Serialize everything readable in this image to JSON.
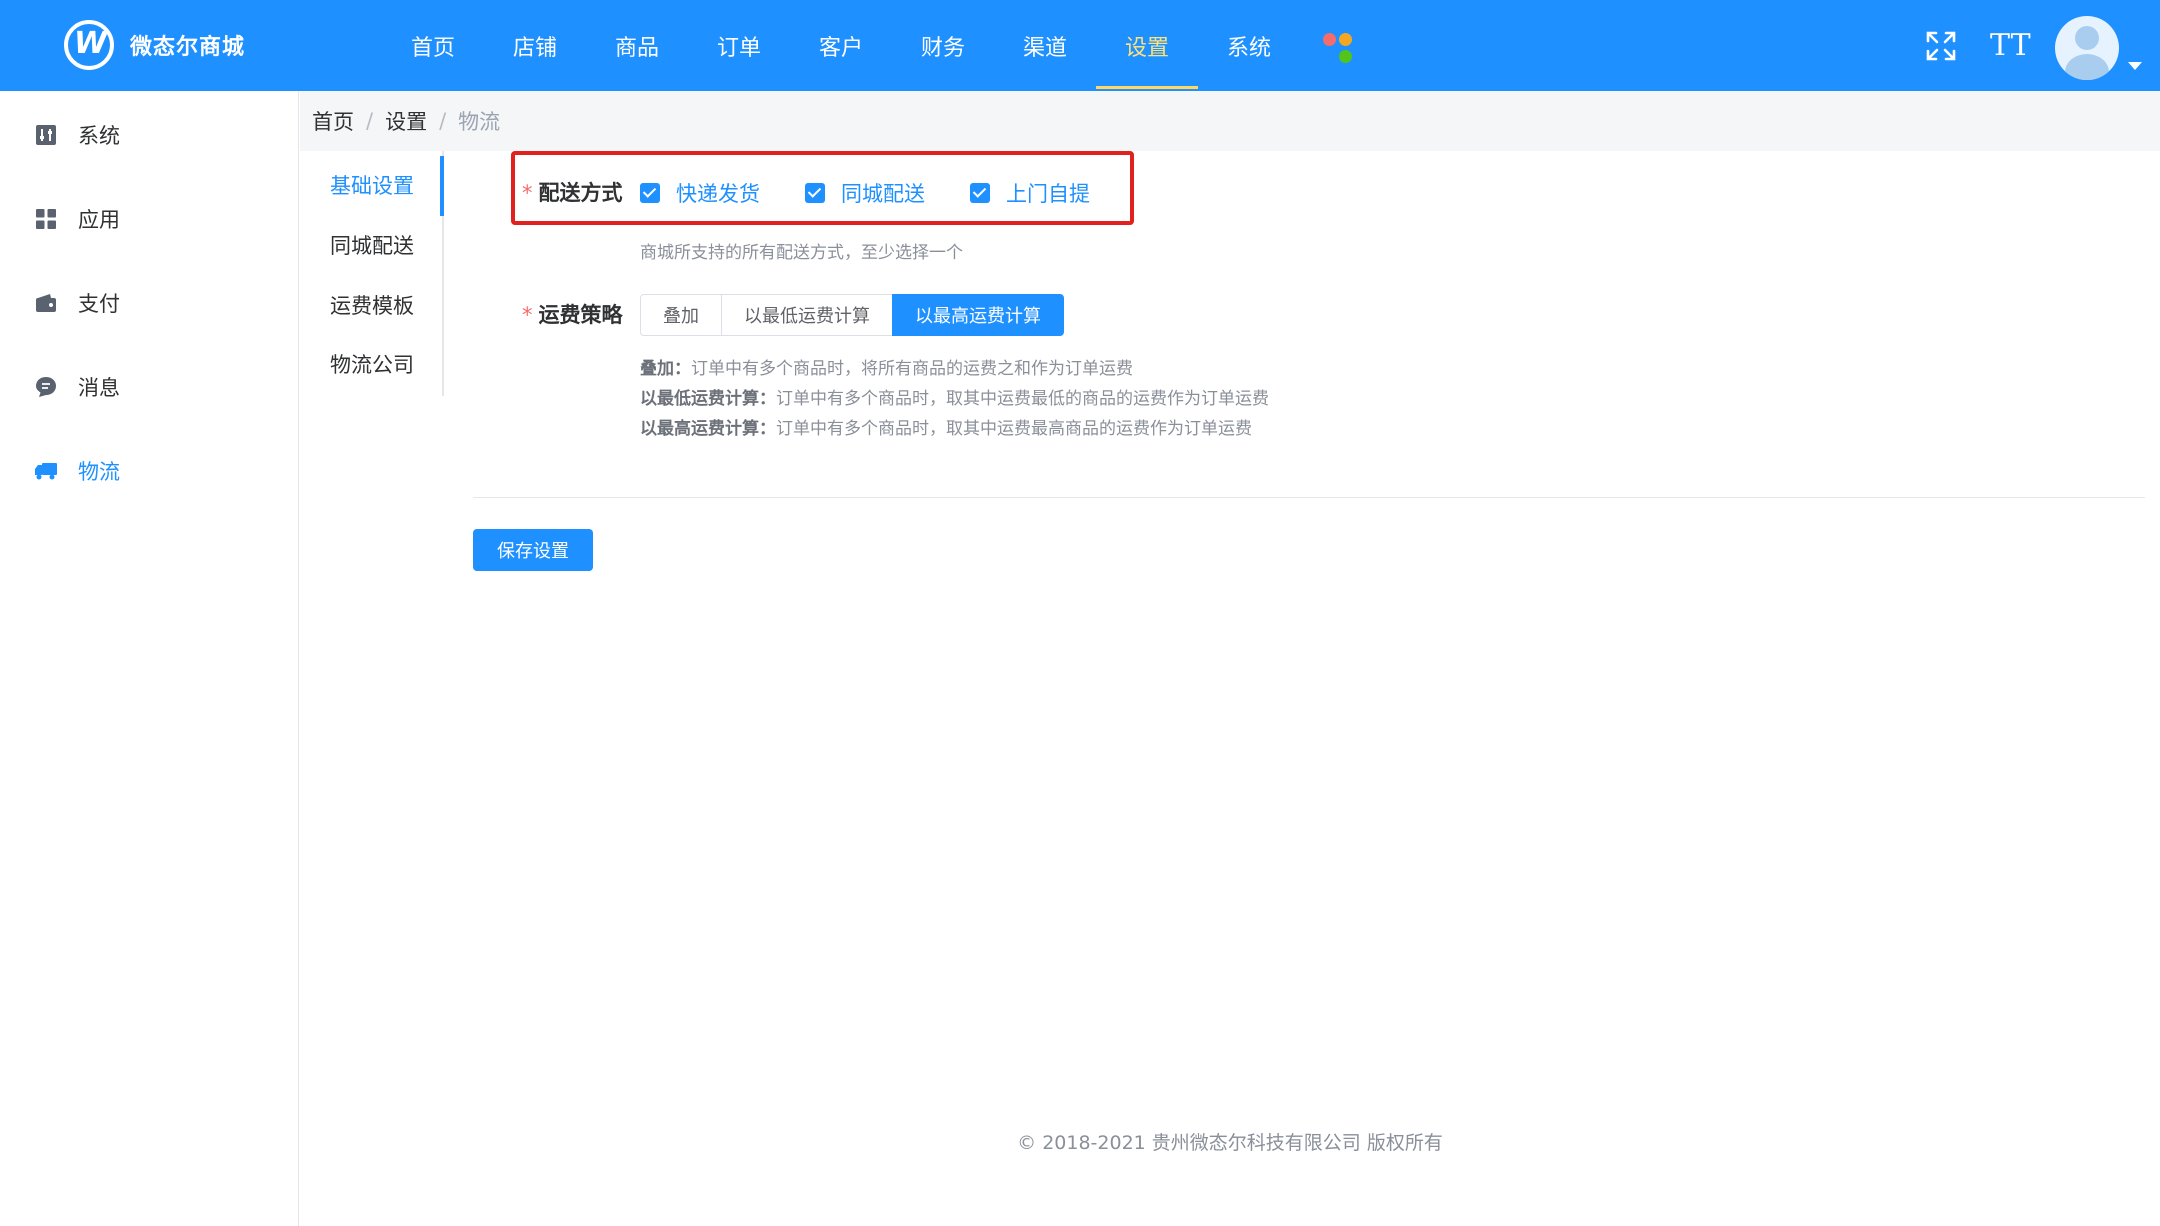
{
  "header": {
    "logo_text": "微态尔商城",
    "nav": [
      "首页",
      "店铺",
      "商品",
      "订单",
      "客户",
      "财务",
      "渠道",
      "设置",
      "系统"
    ],
    "active_nav": "设置",
    "font_icon_text": "TT",
    "brand_color": "#1e90ff",
    "active_nav_color": "#ffd862",
    "apps_icon_colors": [
      "#f56c6c",
      "#f5a623",
      "#1e90ff",
      "#52c41a"
    ]
  },
  "sidebar": {
    "items": [
      {
        "label": "系统",
        "icon": "sliders-icon"
      },
      {
        "label": "应用",
        "icon": "grid-icon"
      },
      {
        "label": "支付",
        "icon": "wallet-icon"
      },
      {
        "label": "消息",
        "icon": "chat-icon"
      },
      {
        "label": "物流",
        "icon": "truck-icon"
      }
    ],
    "active": "物流"
  },
  "breadcrumb": {
    "items": [
      "首页",
      "设置",
      "物流"
    ],
    "separator": "/"
  },
  "submenu": {
    "items": [
      "基础设置",
      "同城配送",
      "运费模板",
      "物流公司"
    ],
    "active": "基础设置"
  },
  "form": {
    "delivery": {
      "label": "配送方式",
      "required_mark": "*",
      "options": [
        {
          "label": "快递发货",
          "checked": true
        },
        {
          "label": "同城配送",
          "checked": true
        },
        {
          "label": "上门自提",
          "checked": true
        }
      ],
      "hint": "商城所支持的所有配送方式，至少选择一个"
    },
    "freight": {
      "label": "运费策略",
      "required_mark": "*",
      "options": [
        "叠加",
        "以最低运费计算",
        "以最高运费计算"
      ],
      "selected": "以最高运费计算",
      "hints": [
        {
          "term": "叠加：",
          "text": "订单中有多个商品时，将所有商品的运费之和作为订单运费"
        },
        {
          "term": "以最低运费计算：",
          "text": "订单中有多个商品时，取其中运费最低的商品的运费作为订单运费"
        },
        {
          "term": "以最高运费计算：",
          "text": "订单中有多个商品时，取其中运费最高商品的运费作为订单运费"
        }
      ]
    },
    "save_label": "保存设置"
  },
  "footer": {
    "copyright": "© 2018-2021 贵州微态尔科技有限公司 版权所有"
  }
}
